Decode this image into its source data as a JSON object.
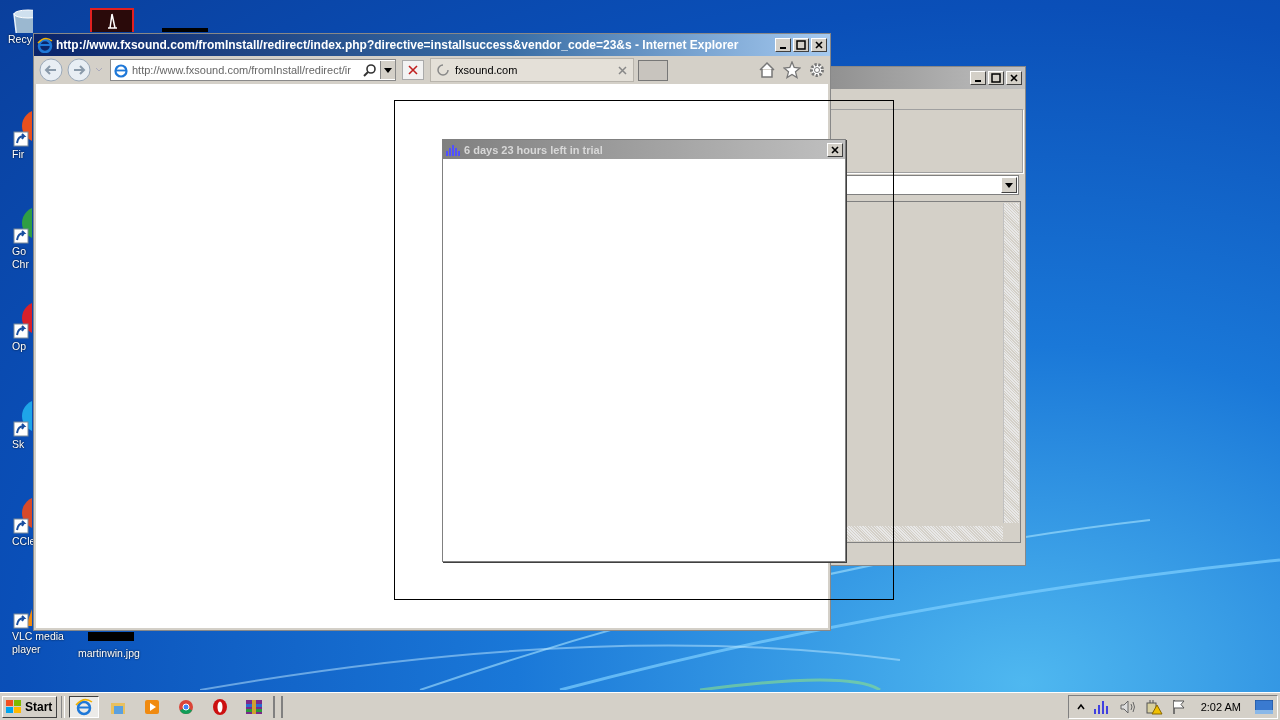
{
  "desktop": {
    "icons": [
      {
        "kind": "recycle",
        "lines": [
          "Recy"
        ]
      },
      {
        "kind": "firefox",
        "lines": [
          "Fir"
        ]
      },
      {
        "kind": "chrome",
        "lines": [
          "Go",
          "Chr"
        ]
      },
      {
        "kind": "opera",
        "lines": [
          "Op"
        ]
      },
      {
        "kind": "skype",
        "lines": [
          "Sk"
        ]
      },
      {
        "kind": "ccleaner",
        "lines": [
          "CCle"
        ]
      },
      {
        "kind": "vlc",
        "lines": [
          "VLC media",
          "player"
        ]
      },
      {
        "kind": "image",
        "lines": [
          "martinwin.jpg"
        ]
      }
    ]
  },
  "browser": {
    "title": "http://www.fxsound.com/fromInstall/redirect/index.php?directive=installsuccess&vendor_code=23&s - Internet Explorer",
    "address": "http://www.fxsound.com/fromInstall/redirect/ir",
    "tab": {
      "label": "fxsound.com",
      "selected": true
    }
  },
  "dialog": {
    "title": "6 days 23 hours left in trial"
  },
  "taskbar": {
    "start": "Start",
    "apps": [
      {
        "kind": "ie",
        "selected": true
      },
      {
        "kind": "folder",
        "selected": false
      },
      {
        "kind": "media",
        "selected": false
      },
      {
        "kind": "chrome",
        "selected": false
      },
      {
        "kind": "opera",
        "selected": false
      },
      {
        "kind": "winrar",
        "selected": false
      }
    ],
    "clock": "2:02 AM"
  }
}
